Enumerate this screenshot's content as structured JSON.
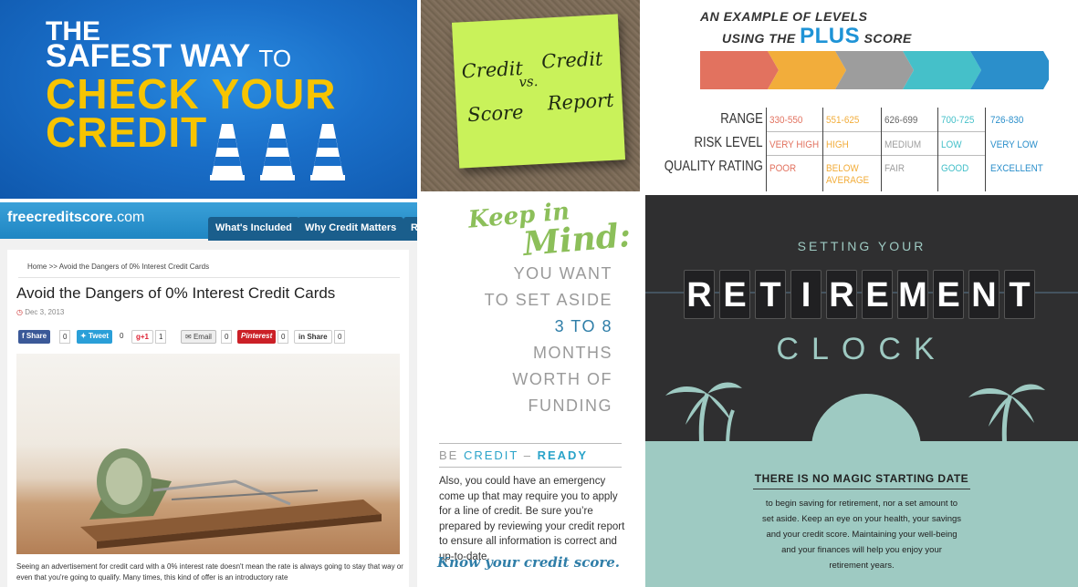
{
  "panel_safest": {
    "line1": "THE",
    "line2_main": "SAFEST WAY ",
    "line2_small": "TO",
    "line3": "CHECK YOUR",
    "line4": "CREDIT",
    "colors": {
      "background": "#1a6fc9",
      "accent": "#f7c400",
      "text": "#ffffff"
    }
  },
  "panel_note": {
    "word_tl": "Credit",
    "word_tr": "Credit",
    "word_bl": "Score",
    "word_br": "Report",
    "vs": "vs.",
    "note_color": "#c9f25a"
  },
  "panel_levels": {
    "heading_line1": "AN EXAMPLE OF LEVELS",
    "heading_line2_pre": "USING THE ",
    "heading_line2_brand": "PLUS",
    "heading_line2_post": " SCORE",
    "row_labels": [
      "RANGE",
      "RISK LEVEL",
      "QUALITY RATING"
    ],
    "columns": [
      {
        "range": "330-550",
        "risk": "VERY HIGH",
        "quality": "POOR",
        "color": "#e2725f"
      },
      {
        "range": "551-625",
        "risk": "HIGH",
        "quality": "BELOW",
        "quality2": "AVERAGE",
        "color": "#f2ad3b"
      },
      {
        "range": "626-699",
        "risk": "MEDIUM",
        "quality": "FAIR",
        "color": "#9d9d9d"
      },
      {
        "range": "700-725",
        "risk": "LOW",
        "quality": "GOOD",
        "color": "#45c0c9"
      },
      {
        "range": "726-830",
        "risk": "VERY LOW",
        "quality": "EXCELLENT",
        "color": "#2b8fcb"
      }
    ]
  },
  "panel_site": {
    "logo_main": "freecreditscore",
    "logo_suffix": ".com",
    "nav": [
      "What's Included",
      "Why Credit Matters",
      "R"
    ],
    "breadcrumb": "Home  >>  Avoid the Dangers of 0% Interest Credit Cards",
    "title": "Avoid the Dangers of 0% Interest Credit Cards",
    "date": "Dec 3, 2013",
    "share_buttons": {
      "facebook": "f  Share",
      "facebook_count": "0",
      "tweet": "Tweet",
      "tweet_count": "0",
      "gplus": "g+1",
      "gplus_count": "1",
      "email": "Email",
      "email_count": "0",
      "pinterest": "Pinterest",
      "pinterest_count": "0",
      "linkedin": "in  Share",
      "linkedin_count": "0"
    },
    "body": "Seeing an advertisement for credit card with a 0% interest rate doesn't mean the rate is always going to stay that way or even that you're going to qualify. Many times, this kind of offer is an introductory rate"
  },
  "panel_keep": {
    "keep": "Keep in",
    "mind": "Mind:",
    "lines": [
      "YOU WANT",
      "TO SET ASIDE",
      "3 TO 8",
      "MONTHS",
      "WORTH OF",
      "FUNDING"
    ],
    "ready_pre": "BE ",
    "ready_credit": "CREDIT",
    "ready_dash": " – ",
    "ready_word": "READY",
    "paragraph": "Also, you could have an emergency come up that may require you to apply for a line of credit. Be sure you’re prepared by reviewing your credit report to ensure all information is correct and up-to-date.",
    "know": "Know your credit score."
  },
  "panel_retire": {
    "setting": "SETTING YOUR",
    "word": [
      "R",
      "E",
      "T",
      "I",
      "R",
      "E",
      "M",
      "E",
      "N",
      "T"
    ],
    "clock": "CLOCK",
    "magic": "THERE IS NO MAGIC STARTING DATE",
    "body_lines": [
      "to begin saving for retirement, nor a set amount to",
      "set aside. Keep an eye on your health, your savings",
      "and your credit score. Maintaining your well-being",
      "and your finances will help you enjoy your",
      "retirement years."
    ],
    "colors": {
      "mint": "#9ecac2",
      "dark": "#2f2f30"
    }
  }
}
